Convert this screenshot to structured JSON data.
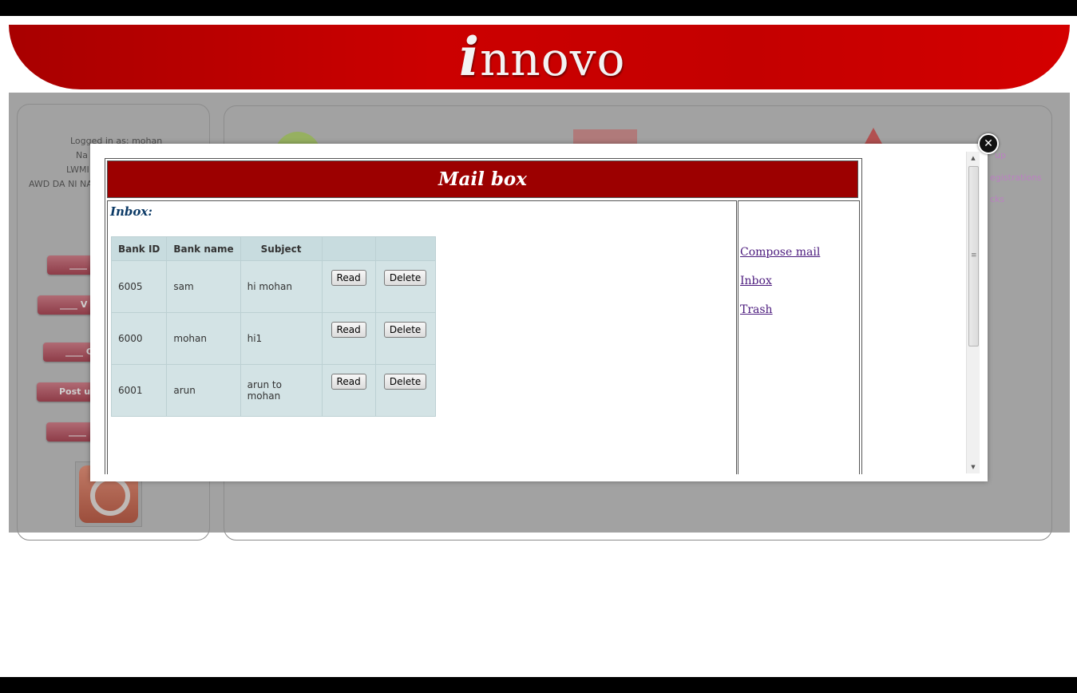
{
  "brand": {
    "logo_i": "i",
    "logo_rest": "nnovo"
  },
  "sidebar": {
    "logged_in_line": "Logged in as: mohan",
    "line2": "Na",
    "line3": "LWMI",
    "line4": "AWD DA NI NA",
    "buttons": [
      "____",
      "____ V",
      "____ C",
      "Post u",
      "____"
    ]
  },
  "background_links": [
    "up",
    "egistrations",
    "cks"
  ],
  "modal": {
    "close_glyph": "✕",
    "title": "Mail box",
    "inbox_heading": "Inbox:",
    "table": {
      "headers": [
        "Bank ID",
        "Bank name",
        "Subject",
        "",
        ""
      ],
      "rows": [
        {
          "id": "6005",
          "name": "sam",
          "subject": "hi mohan",
          "read": "Read",
          "delete": "Delete"
        },
        {
          "id": "6000",
          "name": "mohan",
          "subject": "hi1",
          "read": "Read",
          "delete": "Delete"
        },
        {
          "id": "6001",
          "name": "arun",
          "subject": "arun to mohan",
          "read": "Read",
          "delete": "Delete"
        }
      ]
    },
    "nav": {
      "compose": "Compose mail",
      "inbox": "Inbox",
      "trash": "Trash"
    }
  },
  "icons": {
    "close": "close-icon",
    "power": "power-icon",
    "scroll_up": "scroll-up-arrow-icon",
    "scroll_down": "scroll-down-arrow-icon"
  },
  "colors": {
    "banner_red": "#cc0000",
    "mail_header": "#9c0000",
    "table_bg": "#d3e3e5",
    "link": "#4b1a7d",
    "overlay_gray": "#a2a2a2"
  }
}
